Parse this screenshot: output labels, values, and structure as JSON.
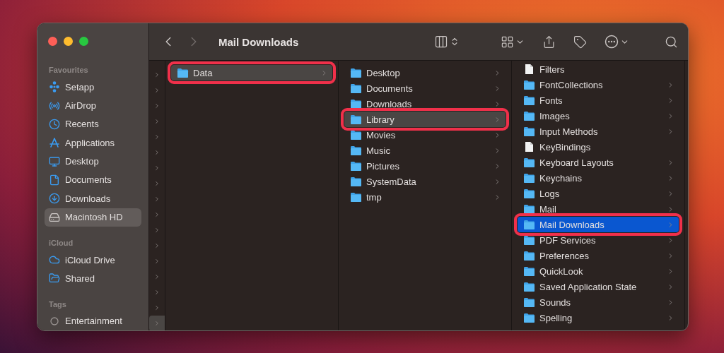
{
  "window": {
    "title": "Mail Downloads"
  },
  "toolbar": {
    "back": {
      "disabled": false
    },
    "forward": {
      "disabled": true
    }
  },
  "sidebar": {
    "sections": [
      {
        "header": "Favourites",
        "items": [
          {
            "label": "Setapp",
            "kind": "setapp",
            "selected": false
          },
          {
            "label": "AirDrop",
            "kind": "airdrop",
            "selected": false
          },
          {
            "label": "Recents",
            "kind": "clock",
            "selected": false
          },
          {
            "label": "Applications",
            "kind": "apps",
            "selected": false
          },
          {
            "label": "Desktop",
            "kind": "desktop",
            "selected": false
          },
          {
            "label": "Documents",
            "kind": "document",
            "selected": false
          },
          {
            "label": "Downloads",
            "kind": "download",
            "selected": false
          },
          {
            "label": "Macintosh HD",
            "kind": "disk",
            "selected": true
          }
        ]
      },
      {
        "header": "iCloud",
        "items": [
          {
            "label": "iCloud Drive",
            "kind": "cloud",
            "selected": false
          },
          {
            "label": "Shared",
            "kind": "shared",
            "selected": false
          }
        ]
      },
      {
        "header": "Tags",
        "items": [
          {
            "label": "Entertainment",
            "kind": "tag",
            "selected": false
          }
        ]
      }
    ]
  },
  "path_column": {
    "rows": [
      {
        "selected": false
      },
      {
        "selected": false
      },
      {
        "selected": false
      },
      {
        "selected": false
      },
      {
        "selected": false
      },
      {
        "selected": false
      },
      {
        "selected": false
      },
      {
        "selected": false
      },
      {
        "selected": false
      },
      {
        "selected": false
      },
      {
        "selected": false
      },
      {
        "selected": false
      },
      {
        "selected": false
      },
      {
        "selected": false
      },
      {
        "selected": false
      },
      {
        "selected": false
      },
      {
        "selected": true
      }
    ]
  },
  "columns": [
    {
      "focused": false,
      "items": [
        {
          "label": "Data",
          "kind": "folder",
          "selected": true,
          "annotated": true,
          "has_children": true
        }
      ]
    },
    {
      "focused": false,
      "items": [
        {
          "label": "Desktop",
          "kind": "folder",
          "selected": false,
          "annotated": false,
          "has_children": true
        },
        {
          "label": "Documents",
          "kind": "folder",
          "selected": false,
          "annotated": false,
          "has_children": true
        },
        {
          "label": "Downloads",
          "kind": "folder",
          "selected": false,
          "annotated": false,
          "has_children": true
        },
        {
          "label": "Library",
          "kind": "folder",
          "selected": true,
          "annotated": true,
          "has_children": true
        },
        {
          "label": "Movies",
          "kind": "folder",
          "selected": false,
          "annotated": false,
          "has_children": true
        },
        {
          "label": "Music",
          "kind": "folder",
          "selected": false,
          "annotated": false,
          "has_children": true
        },
        {
          "label": "Pictures",
          "kind": "folder",
          "selected": false,
          "annotated": false,
          "has_children": true
        },
        {
          "label": "SystemData",
          "kind": "folder",
          "selected": false,
          "annotated": false,
          "has_children": true
        },
        {
          "label": "tmp",
          "kind": "folder",
          "selected": false,
          "annotated": false,
          "has_children": true
        }
      ]
    },
    {
      "focused": true,
      "items": [
        {
          "label": "Filters",
          "kind": "file",
          "selected": false,
          "annotated": false,
          "has_children": false
        },
        {
          "label": "FontCollections",
          "kind": "folder",
          "selected": false,
          "annotated": false,
          "has_children": true
        },
        {
          "label": "Fonts",
          "kind": "folder",
          "selected": false,
          "annotated": false,
          "has_children": true
        },
        {
          "label": "Images",
          "kind": "folder",
          "selected": false,
          "annotated": false,
          "has_children": true
        },
        {
          "label": "Input Methods",
          "kind": "folder",
          "selected": false,
          "annotated": false,
          "has_children": true
        },
        {
          "label": "KeyBindings",
          "kind": "file",
          "selected": false,
          "annotated": false,
          "has_children": false
        },
        {
          "label": "Keyboard Layouts",
          "kind": "folder",
          "selected": false,
          "annotated": false,
          "has_children": true
        },
        {
          "label": "Keychains",
          "kind": "folder",
          "selected": false,
          "annotated": false,
          "has_children": true
        },
        {
          "label": "Logs",
          "kind": "folder",
          "selected": false,
          "annotated": false,
          "has_children": true
        },
        {
          "label": "Mail",
          "kind": "folder",
          "selected": false,
          "annotated": false,
          "has_children": true
        },
        {
          "label": "Mail Downloads",
          "kind": "folder",
          "selected": true,
          "annotated": true,
          "has_children": true
        },
        {
          "label": "PDF Services",
          "kind": "folder",
          "selected": false,
          "annotated": false,
          "has_children": true
        },
        {
          "label": "Preferences",
          "kind": "folder",
          "selected": false,
          "annotated": false,
          "has_children": true
        },
        {
          "label": "QuickLook",
          "kind": "folder",
          "selected": false,
          "annotated": false,
          "has_children": true
        },
        {
          "label": "Saved Application State",
          "kind": "folder",
          "selected": false,
          "annotated": false,
          "has_children": true
        },
        {
          "label": "Sounds",
          "kind": "folder",
          "selected": false,
          "annotated": false,
          "has_children": true
        },
        {
          "label": "Spelling",
          "kind": "folder",
          "selected": false,
          "annotated": false,
          "has_children": true
        }
      ]
    }
  ]
}
